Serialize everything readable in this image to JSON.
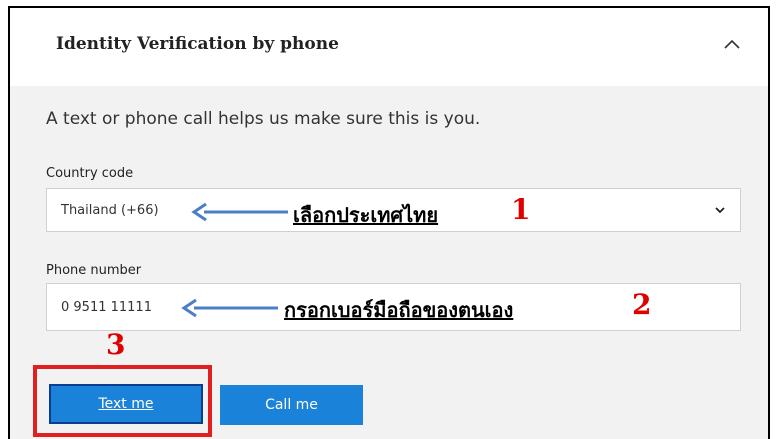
{
  "header": {
    "title": "Identity Verification by phone",
    "collapse_icon": "chevron-up-icon"
  },
  "intro_text": "A text or phone call helps us make sure this is you.",
  "country": {
    "label": "Country code",
    "selected": "Thailand (+66)",
    "dropdown_icon": "chevron-down-icon"
  },
  "phone": {
    "label": "Phone number",
    "value": "0 9511 11111"
  },
  "buttons": {
    "text_me": "Text me",
    "call_me": "Call me"
  },
  "annotations": {
    "step1_text": "เลือกประเทศไทย",
    "step1_num": "1",
    "step2_text": "กรอกเบอร์มือถือของตนเอง",
    "step2_num": "2",
    "step3_num": "3"
  },
  "colors": {
    "primary_button": "#1a82d8",
    "annotation_arrow": "#4a7ec7",
    "annotation_number": "#e00000",
    "highlight_box": "#e02020"
  }
}
